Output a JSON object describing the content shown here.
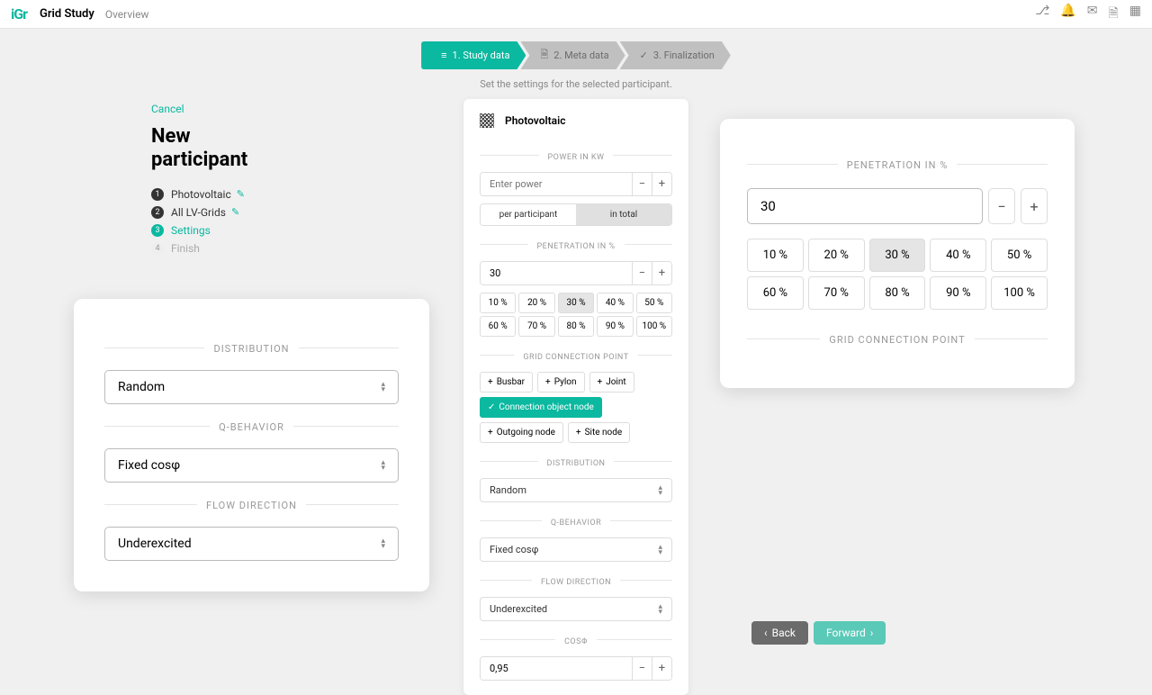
{
  "header": {
    "app": "Grid Study",
    "link": "Overview"
  },
  "stepper": [
    {
      "label": "1. Study data",
      "icon": "≡"
    },
    {
      "label": "2. Meta data",
      "icon": "🗎"
    },
    {
      "label": "3. Finalization",
      "icon": "✓"
    }
  ],
  "subtitle": "Set the settings for the selected participant.",
  "side": {
    "cancel": "Cancel",
    "title1": "New",
    "title2": "participant",
    "steps": [
      {
        "label": "Photovoltaic",
        "edit": true
      },
      {
        "label": "All LV-Grids",
        "edit": true
      },
      {
        "label": "Settings",
        "active": true
      },
      {
        "label": "Finish",
        "muted": true
      }
    ]
  },
  "center": {
    "title": "Photovoltaic",
    "power_label": "POWER IN KW",
    "power_placeholder": "Enter power",
    "toggle1": "per participant",
    "toggle2": "in total",
    "pen_label": "PENETRATION IN %",
    "pen_value": "30",
    "pcts": [
      "10 %",
      "20 %",
      "30 %",
      "40 %",
      "50 %",
      "60 %",
      "70 %",
      "80 %",
      "90 %",
      "100 %"
    ],
    "gcp_label": "GRID CONNECTION POINT",
    "chips": [
      "Busbar",
      "Pylon",
      "Joint",
      "Connection object node",
      "Outgoing node",
      "Site node"
    ],
    "dist_label": "DISTRIBUTION",
    "dist_value": "Random",
    "qb_label": "Q-BEHAVIOR",
    "qb_value": "Fixed cosφ",
    "flow_label": "FLOW DIRECTION",
    "flow_value": "Underexcited",
    "cos_label": "COSΦ",
    "cos_value": "0,95"
  },
  "left": {
    "dist_label": "DISTRIBUTION",
    "dist_value": "Random",
    "qb_label": "Q-BEHAVIOR",
    "qb_value": "Fixed cosφ",
    "flow_label": "FLOW DIRECTION",
    "flow_value": "Underexcited"
  },
  "right": {
    "pen_label": "PENETRATION IN %",
    "pen_value": "30",
    "pcts": [
      "10 %",
      "20 %",
      "30 %",
      "40 %",
      "50 %",
      "60 %",
      "70 %",
      "80 %",
      "90 %",
      "100 %"
    ],
    "gcp_label": "GRID CONNECTION POINT"
  },
  "footer": {
    "back": "Back",
    "forward": "Forward"
  }
}
